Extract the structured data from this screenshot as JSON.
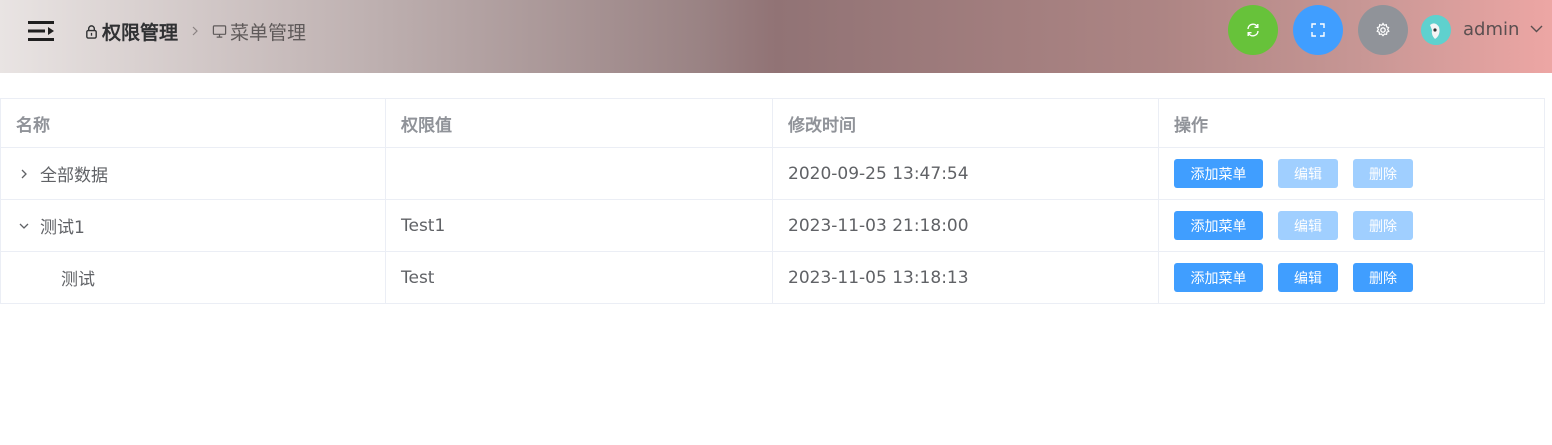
{
  "header": {
    "breadcrumb": [
      {
        "label": "权限管理",
        "icon": "lock-icon"
      },
      {
        "label": "菜单管理",
        "icon": "monitor-icon"
      }
    ],
    "actions": [
      {
        "name": "refresh",
        "icon": "refresh-icon",
        "color": "#67c23a"
      },
      {
        "name": "fullscreen",
        "icon": "fullscreen-icon",
        "color": "#409eff"
      },
      {
        "name": "settings",
        "icon": "gear-icon",
        "color": "#909399"
      }
    ],
    "user": {
      "name": "admin"
    }
  },
  "table": {
    "columns": [
      "名称",
      "权限值",
      "修改时间",
      "操作"
    ],
    "rows": [
      {
        "name": "全部数据",
        "permission": "",
        "modified": "2020-09-25 13:47:54",
        "expand": "collapsed",
        "edit_disabled": true,
        "delete_disabled": true
      },
      {
        "name": "测试1",
        "permission": "Test1",
        "modified": "2023-11-03 21:18:00",
        "expand": "expanded",
        "edit_disabled": true,
        "delete_disabled": true
      },
      {
        "name": "测试",
        "permission": "Test",
        "modified": "2023-11-05 13:18:13",
        "expand": "none",
        "edit_disabled": false,
        "delete_disabled": false
      }
    ],
    "actions": {
      "add": "添加菜单",
      "edit": "编辑",
      "delete": "删除"
    }
  }
}
